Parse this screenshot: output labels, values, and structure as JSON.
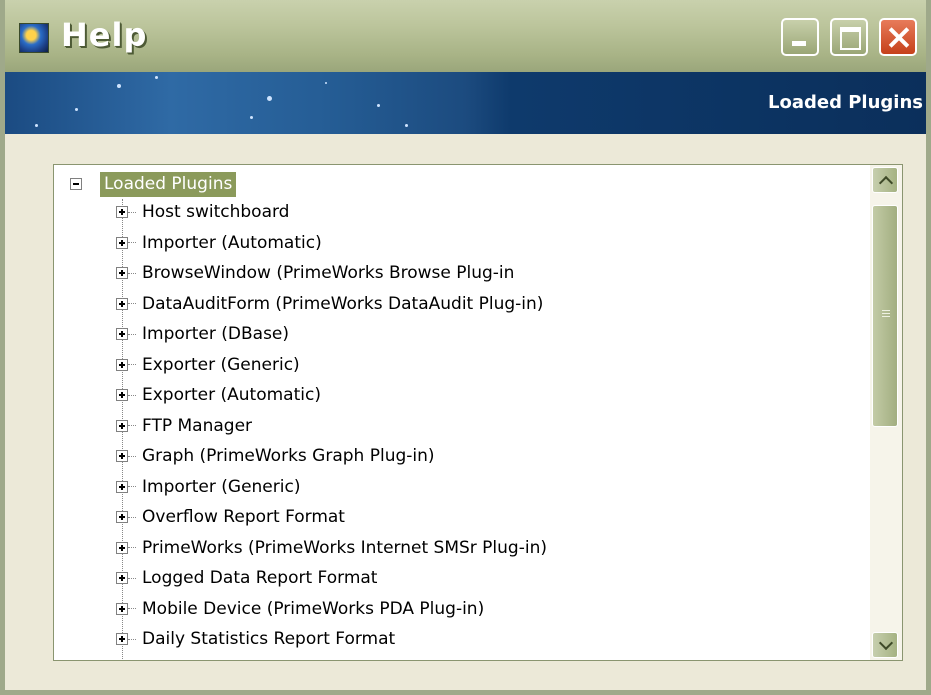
{
  "window": {
    "title": "Help",
    "icon": "help-app-icon",
    "controls": {
      "minimize": "minimize-icon",
      "maximize": "maximize-icon",
      "close": "close-icon"
    }
  },
  "banner": {
    "title": "Loaded Plugins"
  },
  "tree": {
    "root": {
      "label": "Loaded Plugins",
      "expanded": true,
      "selected": true
    },
    "items": [
      {
        "label": "Host switchboard"
      },
      {
        "label": "Importer (Automatic)"
      },
      {
        "label": "BrowseWindow (PrimeWorks Browse Plug-in"
      },
      {
        "label": "DataAuditForm (PrimeWorks DataAudit Plug-in)"
      },
      {
        "label": "Importer (DBase)"
      },
      {
        "label": "Exporter (Generic)"
      },
      {
        "label": "Exporter (Automatic)"
      },
      {
        "label": "FTP Manager"
      },
      {
        "label": "Graph (PrimeWorks Graph Plug-in)"
      },
      {
        "label": "Importer (Generic)"
      },
      {
        "label": "Overflow Report Format"
      },
      {
        "label": "PrimeWorks (PrimeWorks Internet SMSr Plug-in)"
      },
      {
        "label": "Logged Data Report Format"
      },
      {
        "label": "Mobile Device (PrimeWorks PDA Plug-in)"
      },
      {
        "label": "Daily Statistics Report Format"
      }
    ]
  },
  "colors": {
    "titlebar": "#aab488",
    "banner": "#0e3a6c",
    "selection": "#8b9a5b",
    "close_button": "#d0532b"
  }
}
